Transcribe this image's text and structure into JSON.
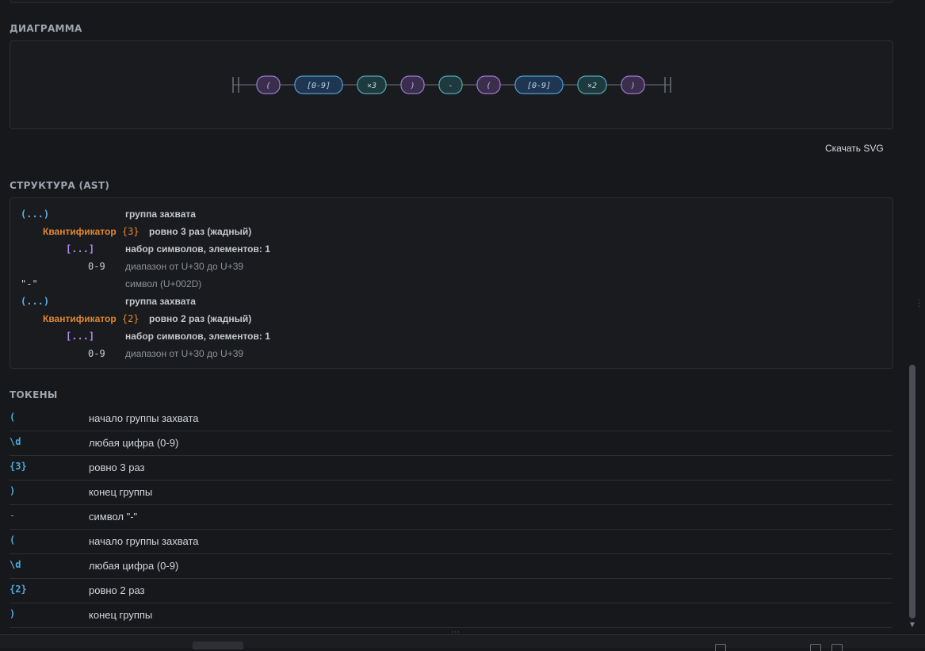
{
  "sections": {
    "diagram_title": "ДИАГРАММА",
    "ast_title": "СТРУКТУРА (AST)",
    "tokens_title": "ТОКЕНЫ"
  },
  "diagram": {
    "download_label": "Скачать SVG",
    "nodes": [
      {
        "label": "(",
        "kind": "group"
      },
      {
        "label": "[0-9]",
        "kind": "class"
      },
      {
        "label": "×3",
        "kind": "quant"
      },
      {
        "label": ")",
        "kind": "group"
      },
      {
        "label": "-",
        "kind": "literal"
      },
      {
        "label": "(",
        "kind": "group"
      },
      {
        "label": "[0-9]",
        "kind": "class"
      },
      {
        "label": "×2",
        "kind": "quant"
      },
      {
        "label": ")",
        "kind": "group"
      }
    ],
    "colors": {
      "group": {
        "fill": "#3a2e4c",
        "stroke": "#9b7bd1",
        "text": "#c9b3ee"
      },
      "class": {
        "fill": "#1f3650",
        "stroke": "#4d9be0",
        "text": "#b9d8f5"
      },
      "quant": {
        "fill": "#1f3a3f",
        "stroke": "#4fa9b6",
        "text": "#b6dde2"
      },
      "literal": {
        "fill": "#1f3a3f",
        "stroke": "#4fa9b6",
        "text": "#b6dde2"
      },
      "line": "#6b6f76"
    }
  },
  "ast": {
    "rows": [
      {
        "node": "(...)",
        "desc": "группа захвата"
      },
      {
        "kw": "Квантификатор",
        "br": "{3}",
        "desc": "ровно 3 раз (жадный)"
      },
      {
        "node": "[...]",
        "desc": "набор символов, элементов: 1"
      },
      {
        "node": "0-9",
        "desc": "диапазон от U+30 до U+39"
      },
      {
        "node": "\"-\"",
        "desc": "символ (U+002D)"
      },
      {
        "node": "(...)",
        "desc": "группа захвата"
      },
      {
        "kw": "Квантификатор",
        "br": "{2}",
        "desc": "ровно 2 раз (жадный)"
      },
      {
        "node": "[...]",
        "desc": "набор символов, элементов: 1"
      },
      {
        "node": "0-9",
        "desc": "диапазон от U+30 до U+39"
      }
    ]
  },
  "tokens": [
    {
      "code": "(",
      "desc": "начало группы захвата"
    },
    {
      "code": "\\d",
      "desc": "любая цифра (0-9)"
    },
    {
      "code": "{3}",
      "desc": "ровно 3 раз"
    },
    {
      "code": ")",
      "desc": "конец группы"
    },
    {
      "code": "-",
      "desc": "символ \"-\""
    },
    {
      "code": "(",
      "desc": "начало группы захвата"
    },
    {
      "code": "\\d",
      "desc": "любая цифра (0-9)"
    },
    {
      "code": "{2}",
      "desc": "ровно 2 раз"
    },
    {
      "code": ")",
      "desc": "конец группы"
    }
  ]
}
